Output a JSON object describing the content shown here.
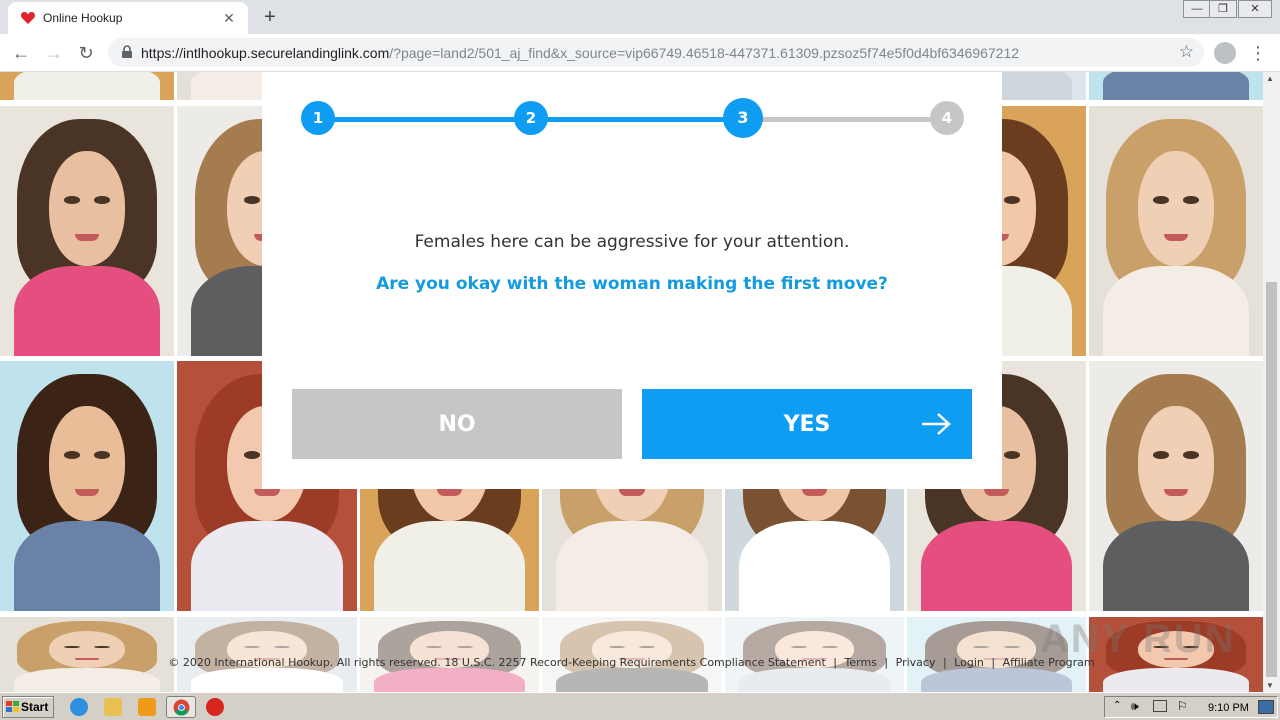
{
  "browser": {
    "tab_title": "Online Hookup",
    "tab_close": "✕",
    "new_tab": "+",
    "url_host": "https://intlhookup.securelandinglink.com",
    "url_rest": "/?page=land2/501_aj_find&x_source=vip66749.46518-447371.61309.pzsoz5f74e5f0d4bf6346967212",
    "back": "←",
    "forward": "→",
    "reload": "↻",
    "star": "☆",
    "menu": "⋮",
    "win_min": "—",
    "win_max": "❐",
    "win_close": "✕"
  },
  "survey": {
    "steps": [
      "1",
      "2",
      "3",
      "4"
    ],
    "current_step": 3,
    "statement": "Females here can be aggressive for your attention.",
    "question": "Are you okay with the woman making the first move?",
    "no_label": "NO",
    "yes_label": "YES"
  },
  "footer": {
    "copyright": "© 2020 International Hookup. All rights reserved. 18 U.S.C. 2257 Record-Keeping Requirements Compliance Statement",
    "terms": "Terms",
    "privacy": "Privacy",
    "login": "Login",
    "affiliate": "Affiliate Program",
    "sep": "|"
  },
  "watermark": "ANY RUN",
  "taskbar": {
    "start_label": "Start",
    "clock": "9:10 PM"
  },
  "colors": {
    "accent": "#0f9cf3",
    "question": "#139bde",
    "inactive": "#c6c6c6"
  }
}
